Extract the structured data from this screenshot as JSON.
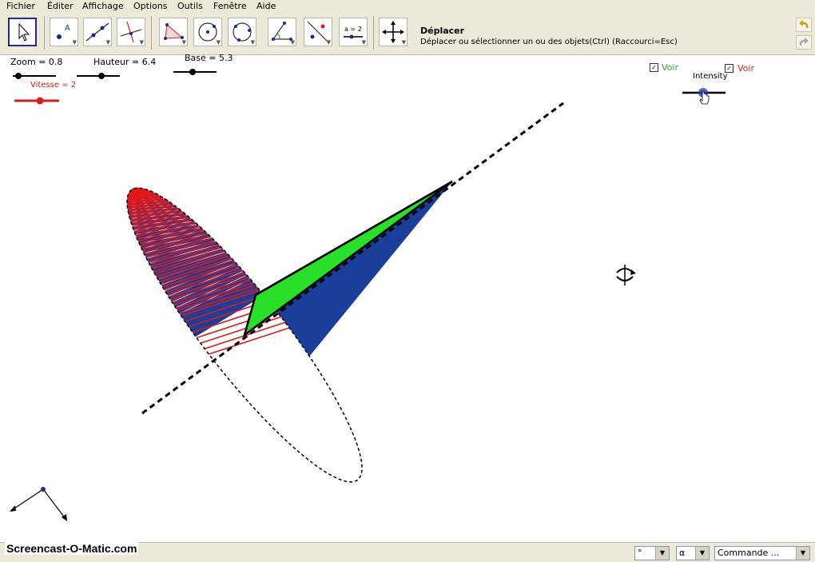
{
  "menu": {
    "items": [
      {
        "id": "fichier",
        "label": "Fichier"
      },
      {
        "id": "editer",
        "label": "Éditer"
      },
      {
        "id": "affichage",
        "label": "Affichage"
      },
      {
        "id": "options",
        "label": "Options"
      },
      {
        "id": "outils",
        "label": "Outils"
      },
      {
        "id": "fenetre",
        "label": "Fenêtre"
      },
      {
        "id": "aide",
        "label": "Aide"
      }
    ]
  },
  "toolbar": {
    "tools": [
      {
        "id": "move",
        "icon": "cursor-arrow-icon",
        "selected": true
      },
      {
        "id": "point",
        "icon": "point-icon",
        "selected": false
      },
      {
        "id": "line",
        "icon": "line-through-two-points-icon",
        "selected": false
      },
      {
        "id": "perpendicular",
        "icon": "perpendicular-line-icon",
        "selected": false
      },
      {
        "id": "polygon",
        "icon": "polygon-icon",
        "selected": false
      },
      {
        "id": "circle",
        "icon": "circle-center-point-icon",
        "selected": false
      },
      {
        "id": "circle3",
        "icon": "circle-three-points-icon",
        "selected": false
      },
      {
        "id": "angle",
        "icon": "angle-icon",
        "selected": false
      },
      {
        "id": "reflect",
        "icon": "reflect-icon",
        "selected": false
      },
      {
        "id": "slider",
        "icon": "slider-icon",
        "selected": false
      },
      {
        "id": "move-view",
        "icon": "move-graphics-view-icon",
        "selected": false
      }
    ],
    "active_title": "Déplacer",
    "active_desc": "Déplacer ou sélectionner un ou des objets(Ctrl) (Raccourci=Esc)",
    "slider_icon_text": "a = 2"
  },
  "sliders": {
    "zoom": {
      "label": "Zoom = 0.8",
      "value": 0.8
    },
    "hauteur": {
      "label": "Hauteur = 6.4",
      "value": 6.4
    },
    "base": {
      "label": "Base = 5.3",
      "value": 5.3
    },
    "vitesse": {
      "label": "Vitesse = 2",
      "value": 2
    },
    "intensity": {
      "label": "Intensity"
    }
  },
  "checkboxes": {
    "voir_green": {
      "label": "Voir",
      "checked": true
    },
    "voir_red": {
      "label": "Voir",
      "checked": true
    }
  },
  "colors": {
    "cone_blue": "#1a3f9a",
    "cone_red": "#e01818",
    "triangle_green": "#28e028",
    "axis": "#000000",
    "slider_red": "#d81c1c"
  },
  "inputbar": {
    "combo1": "°",
    "combo2": "α",
    "command": "Commande ..."
  },
  "watermark": "Screencast-O-Matic.com"
}
